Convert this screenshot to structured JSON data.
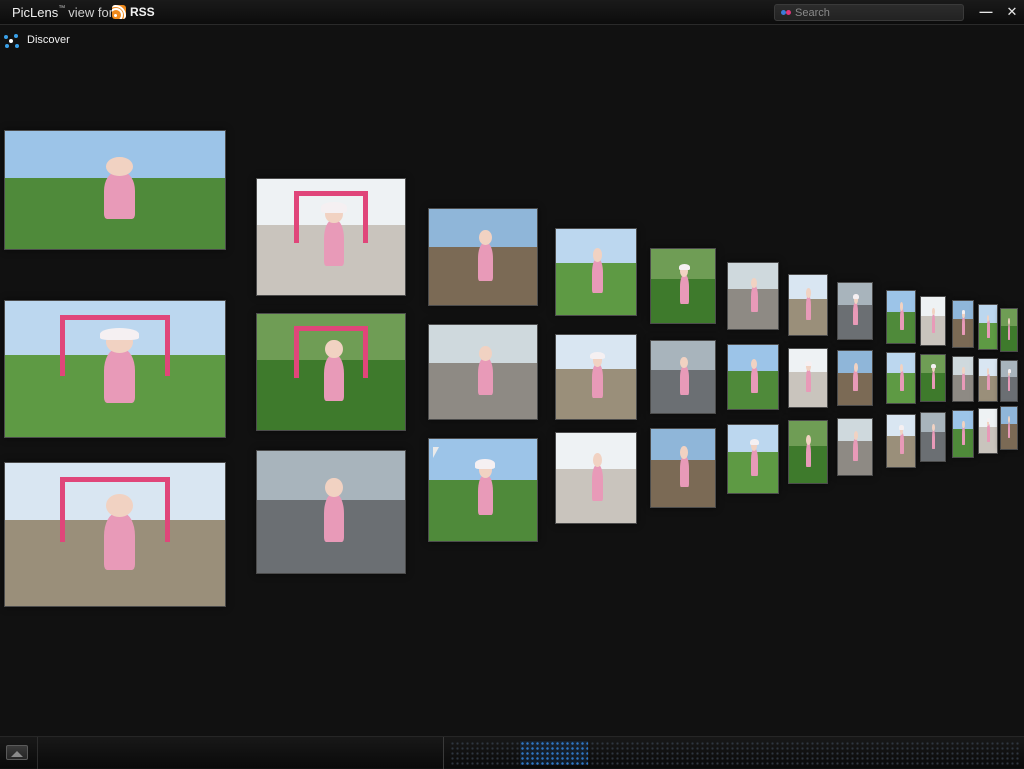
{
  "window": {
    "app_name": "PicLens",
    "trademark": "™",
    "view_for": "view for",
    "feed_label": "RSS",
    "minimize_glyph": "—",
    "close_glyph": "✕"
  },
  "search": {
    "placeholder": "Search",
    "value": ""
  },
  "discover": {
    "label": "Discover"
  },
  "photo_wall": {
    "tile_count": 56,
    "subject": "photos of a toddler in pink outdoors"
  },
  "scrubber": {
    "position_fraction": 0.14
  },
  "colors": {
    "background": "#111111",
    "rss_orange": "#f08a1c",
    "accent_blue": "#2e78c8",
    "search_dot_pink": "#e0357a"
  },
  "icons": [
    "rss-icon",
    "search-icon",
    "discover-icon",
    "fullscreen-icon",
    "minimize-icon",
    "close-icon"
  ]
}
